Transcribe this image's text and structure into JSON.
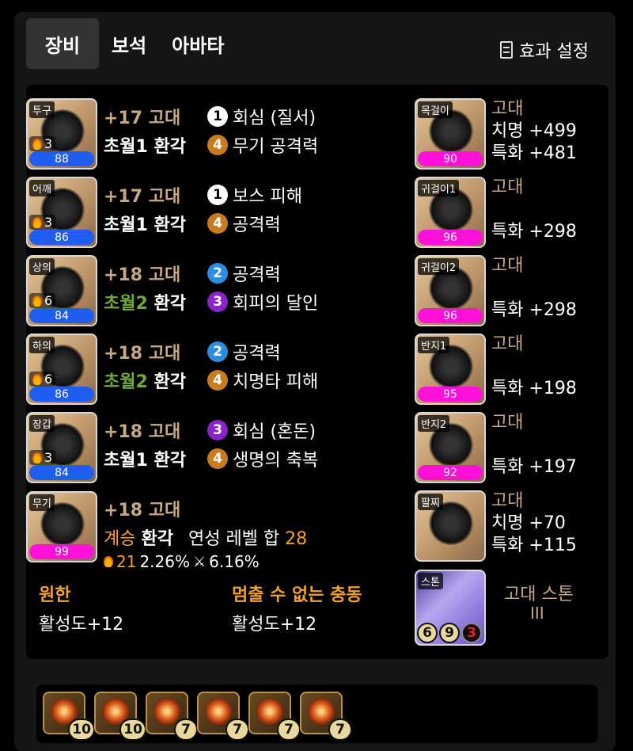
{
  "tabs": [
    "장비",
    "보석",
    "아바타"
  ],
  "effect_settings": "효과 설정",
  "equipment": [
    {
      "slot": "투구",
      "level": "3",
      "quality": "88",
      "upgrade": "+17 고대",
      "transcend": "초월1",
      "elixir": "환각",
      "effects": [
        {
          "n": "1",
          "color": "white",
          "text": "회심 (질서)"
        },
        {
          "n": "4",
          "color": "orange",
          "text": "무기 공격력"
        }
      ]
    },
    {
      "slot": "어깨",
      "level": "3",
      "quality": "86",
      "upgrade": "+17 고대",
      "transcend": "초월1",
      "elixir": "환각",
      "effects": [
        {
          "n": "1",
          "color": "white",
          "text": "보스 피해"
        },
        {
          "n": "4",
          "color": "orange",
          "text": "공격력"
        }
      ]
    },
    {
      "slot": "상의",
      "level": "6",
      "quality": "84",
      "upgrade": "+18 고대",
      "transcend": "초월2",
      "elixir": "환각",
      "effects": [
        {
          "n": "2",
          "color": "blue",
          "text": "공격력"
        },
        {
          "n": "3",
          "color": "purple",
          "text": "회피의 달인"
        }
      ]
    },
    {
      "slot": "하의",
      "level": "6",
      "quality": "86",
      "upgrade": "+18 고대",
      "transcend": "초월2",
      "elixir": "환각",
      "effects": [
        {
          "n": "2",
          "color": "blue",
          "text": "공격력"
        },
        {
          "n": "4",
          "color": "orange",
          "text": "치명타 피해"
        }
      ]
    },
    {
      "slot": "장갑",
      "level": "3",
      "quality": "84",
      "upgrade": "+18 고대",
      "transcend": "초월1",
      "elixir": "환각",
      "effects": [
        {
          "n": "3",
          "color": "purple",
          "text": "회심 (혼돈)"
        },
        {
          "n": "4",
          "color": "orange",
          "text": "생명의 축복"
        }
      ]
    }
  ],
  "weapon": {
    "slot": "무기",
    "quality": "99",
    "upgrade": "+18 고대",
    "inherit": "계승",
    "elixir": "환각",
    "sum_label": "연성 레벨 합",
    "sum_value": "28",
    "fire": "21",
    "p1": "2.26%",
    "p2": "6.16%"
  },
  "set_effects": [
    {
      "name": "원한",
      "value": "활성도+12"
    },
    {
      "name": "멈출 수 없는 충동",
      "value": "활성도+12"
    }
  ],
  "accessories": [
    {
      "slot": "목걸이",
      "quality": "90",
      "grade": "고대",
      "stats": [
        "치명 +499",
        "특화 +481"
      ]
    },
    {
      "slot": "귀걸이1",
      "quality": "96",
      "grade": "고대",
      "stats": [
        "",
        "특화 +298"
      ]
    },
    {
      "slot": "귀걸이2",
      "quality": "96",
      "grade": "고대",
      "stats": [
        "",
        "특화 +298"
      ]
    },
    {
      "slot": "반지1",
      "quality": "95",
      "grade": "고대",
      "stats": [
        "",
        "특화 +198"
      ]
    },
    {
      "slot": "반지2",
      "quality": "92",
      "grade": "고대",
      "stats": [
        "",
        "특화 +197"
      ]
    },
    {
      "slot": "팔찌",
      "quality": "",
      "grade": "고대",
      "stats": [
        "치명 +70",
        "특화 +115"
      ]
    }
  ],
  "stone": {
    "slot": "스톤",
    "name": "고대 스톤",
    "tier": "III",
    "pips": [
      "6",
      "9",
      "3"
    ]
  },
  "gems": [
    "10",
    "10",
    "7",
    "7",
    "7",
    "7"
  ]
}
